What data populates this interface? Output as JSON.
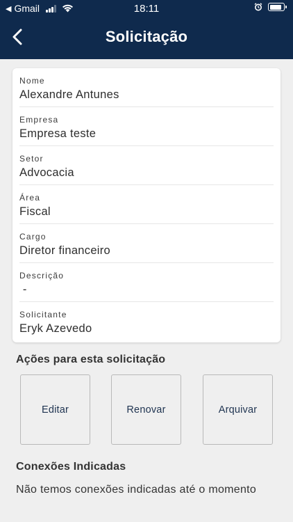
{
  "status_bar": {
    "back_label": "◀",
    "carrier": "Gmail",
    "time": "18:11",
    "battery_level": 0.85
  },
  "header": {
    "title": "Solicitação"
  },
  "fields": [
    {
      "label": "Nome",
      "value": "Alexandre Antunes"
    },
    {
      "label": "Empresa",
      "value": "Empresa teste"
    },
    {
      "label": "Setor",
      "value": "Advocacia"
    },
    {
      "label": "Área",
      "value": "Fiscal"
    },
    {
      "label": "Cargo",
      "value": "Diretor financeiro"
    },
    {
      "label": "Descrição",
      "value": " -"
    },
    {
      "label": "Solicitante",
      "value": "Eryk Azevedo"
    }
  ],
  "actions": {
    "title": "Ações para esta solicitação",
    "edit_label": "Editar",
    "renew_label": "Renovar",
    "archive_label": "Arquivar"
  },
  "connections": {
    "title": "Conexões Indicadas",
    "empty_text": "Não temos conexões indicadas até o momento"
  },
  "colors": {
    "header_bg": "#0f2a4d",
    "page_bg": "#efefef",
    "button_text": "#1e3350"
  }
}
